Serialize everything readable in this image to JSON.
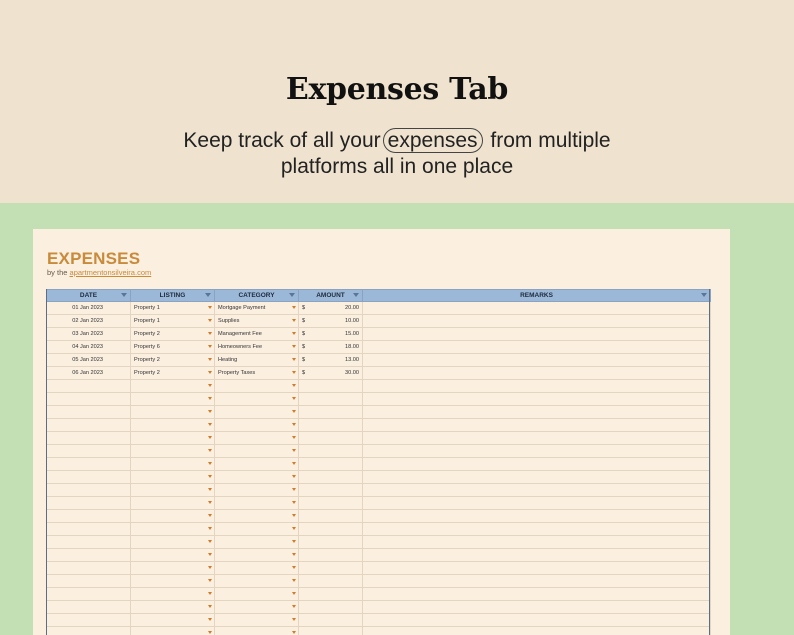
{
  "hero": {
    "title": "Expenses Tab",
    "subtitle_before": "Keep track of all your",
    "subtitle_highlight": "expenses",
    "subtitle_after": "from multiple",
    "subtitle_line2": "platforms all in one place"
  },
  "sheet": {
    "title": "EXPENSES",
    "byline_prefix": "by the",
    "byline_link": "apartmentonsilveira.com",
    "columns": [
      "DATE",
      "LISTING",
      "CATEGORY",
      "AMOUNT",
      "REMARKS"
    ],
    "currency_symbol": "$",
    "rows": [
      {
        "date": "01 Jan 2023",
        "listing": "Property 1",
        "category": "Mortgage Payment",
        "amount": "20.00",
        "remarks": ""
      },
      {
        "date": "02 Jan 2023",
        "listing": "Property 1",
        "category": "Supplies",
        "amount": "10.00",
        "remarks": ""
      },
      {
        "date": "03 Jan 2023",
        "listing": "Property 2",
        "category": "Management Fee",
        "amount": "15.00",
        "remarks": ""
      },
      {
        "date": "04 Jan 2023",
        "listing": "Property 6",
        "category": "Homeowners Fee",
        "amount": "18.00",
        "remarks": ""
      },
      {
        "date": "05 Jan 2023",
        "listing": "Property 2",
        "category": "Heating",
        "amount": "13.00",
        "remarks": ""
      },
      {
        "date": "06 Jan 2023",
        "listing": "Property 2",
        "category": "Property Taxes",
        "amount": "30.00",
        "remarks": ""
      }
    ],
    "empty_row_count": 20
  },
  "colors": {
    "hero_bg": "#efe3cf",
    "page_bg": "#c3e0b5",
    "sheet_bg": "#fbefe0",
    "accent": "#c98a3a",
    "header_bg": "#9bb8d9"
  }
}
